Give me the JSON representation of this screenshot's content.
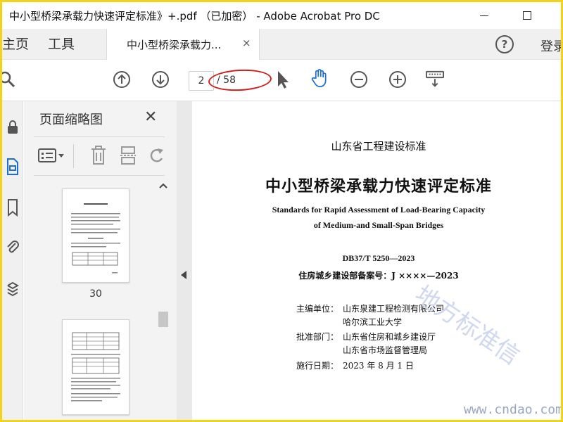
{
  "window": {
    "title": "中小型桥梁承载力快速评定标准》+.pdf （已加密） - Adobe Acrobat Pro DC"
  },
  "tabs": {
    "home": "主页",
    "tools": "工具",
    "document": "中小型桥梁承载力...",
    "close": "×",
    "help": "?",
    "login": "登录"
  },
  "toolbar": {
    "current_page": "2",
    "total_pages": "/ 58"
  },
  "thumbnail_panel": {
    "title": "页面缩略图",
    "close": "✕",
    "thumbnails": [
      {
        "page_number": "30"
      }
    ]
  },
  "document": {
    "header": "山东省工程建设标准",
    "title": "中小型桥梁承载力快速评定标准",
    "english_title_line1": "Standards for Rapid Assessment of Load-Bearing Capacity",
    "english_title_line2": "of Medium-and Small-Span Bridges",
    "standard_code": "DB37/T  5250—2023",
    "record_number": "住房城乡建设部备案号：J ××××—2023",
    "editor_label": "主编单位：",
    "editor_1": "山东泉建工程检测有限公司",
    "editor_2": "哈尔滨工业大学",
    "approval_label": "批准部门：",
    "approval_1": "山东省住房和城乡建设厅",
    "approval_2": "山东省市场监督管理局",
    "effective_label": "施行日期：",
    "effective_date": "2023 年 8 月 1 日"
  },
  "overlays": {
    "watermark_text": "地方标准信",
    "site_mark": "www.cndao.com",
    "highlight_color": "#d31c1c"
  },
  "icons": {
    "toolbar": [
      "search-icon",
      "arrow-up-icon",
      "arrow-down-icon",
      "pointer-icon",
      "hand-icon",
      "minus-icon",
      "plus-icon",
      "keyboard-icon"
    ],
    "rail": [
      "lock-icon",
      "page-icon",
      "bookmark-icon",
      "paperclip-icon",
      "layers-icon"
    ],
    "panel": [
      "options-icon",
      "trash-icon",
      "extract-icon",
      "rotate-icon"
    ]
  }
}
